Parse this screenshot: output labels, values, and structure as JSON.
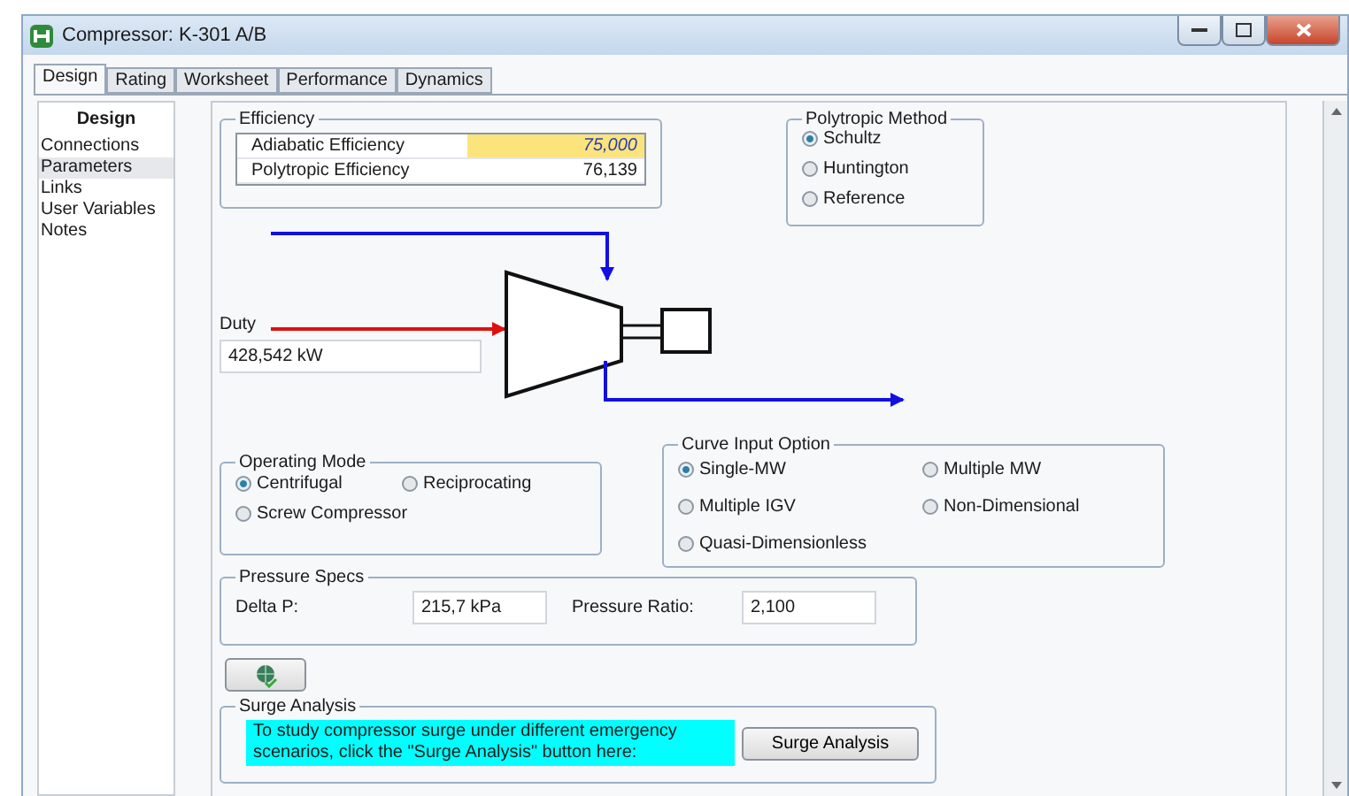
{
  "window": {
    "title": "Compressor: K-301 A/B"
  },
  "tabs": [
    {
      "label": "Design",
      "selected": true
    },
    {
      "label": "Rating",
      "selected": false
    },
    {
      "label": "Worksheet",
      "selected": false
    },
    {
      "label": "Performance",
      "selected": false
    },
    {
      "label": "Dynamics",
      "selected": false
    }
  ],
  "sidebar": {
    "title": "Design",
    "items": [
      {
        "label": "Connections",
        "selected": false
      },
      {
        "label": "Parameters",
        "selected": true
      },
      {
        "label": "Links",
        "selected": false
      },
      {
        "label": "User Variables",
        "selected": false
      },
      {
        "label": "Notes",
        "selected": false
      }
    ]
  },
  "efficiency": {
    "title": "Efficiency",
    "rows": [
      {
        "label": "Adiabatic Efficiency",
        "value": "75,000",
        "specified": true
      },
      {
        "label": "Polytropic Efficiency",
        "value": "76,139",
        "specified": false
      }
    ]
  },
  "polytropic_method": {
    "title": "Polytropic Method",
    "options": [
      {
        "label": "Schultz",
        "selected": true
      },
      {
        "label": "Huntington",
        "selected": false
      },
      {
        "label": "Reference",
        "selected": false
      }
    ]
  },
  "duty": {
    "label": "Duty",
    "value": "428,542 kW"
  },
  "operating_mode": {
    "title": "Operating Mode",
    "options": [
      {
        "label": "Centrifugal",
        "selected": true
      },
      {
        "label": "Reciprocating",
        "selected": false
      },
      {
        "label": "Screw Compressor",
        "selected": false
      }
    ]
  },
  "curve_input_option": {
    "title": "Curve Input Option",
    "options": [
      {
        "label": "Single-MW",
        "selected": true
      },
      {
        "label": "Multiple MW",
        "selected": false
      },
      {
        "label": "Multiple IGV",
        "selected": false
      },
      {
        "label": "Non-Dimensional",
        "selected": false
      },
      {
        "label": "Quasi-Dimensionless",
        "selected": false
      }
    ]
  },
  "pressure_specs": {
    "title": "Pressure Specs",
    "fields": [
      {
        "label": "Delta P:",
        "value": "215,7 kPa"
      },
      {
        "label": "Pressure Ratio:",
        "value": "2,100"
      }
    ]
  },
  "surge_analysis": {
    "title": "Surge Analysis",
    "note": "To study compressor surge under different emergency scenarios, click the \"Surge Analysis\" button here:",
    "button": "Surge Analysis"
  }
}
